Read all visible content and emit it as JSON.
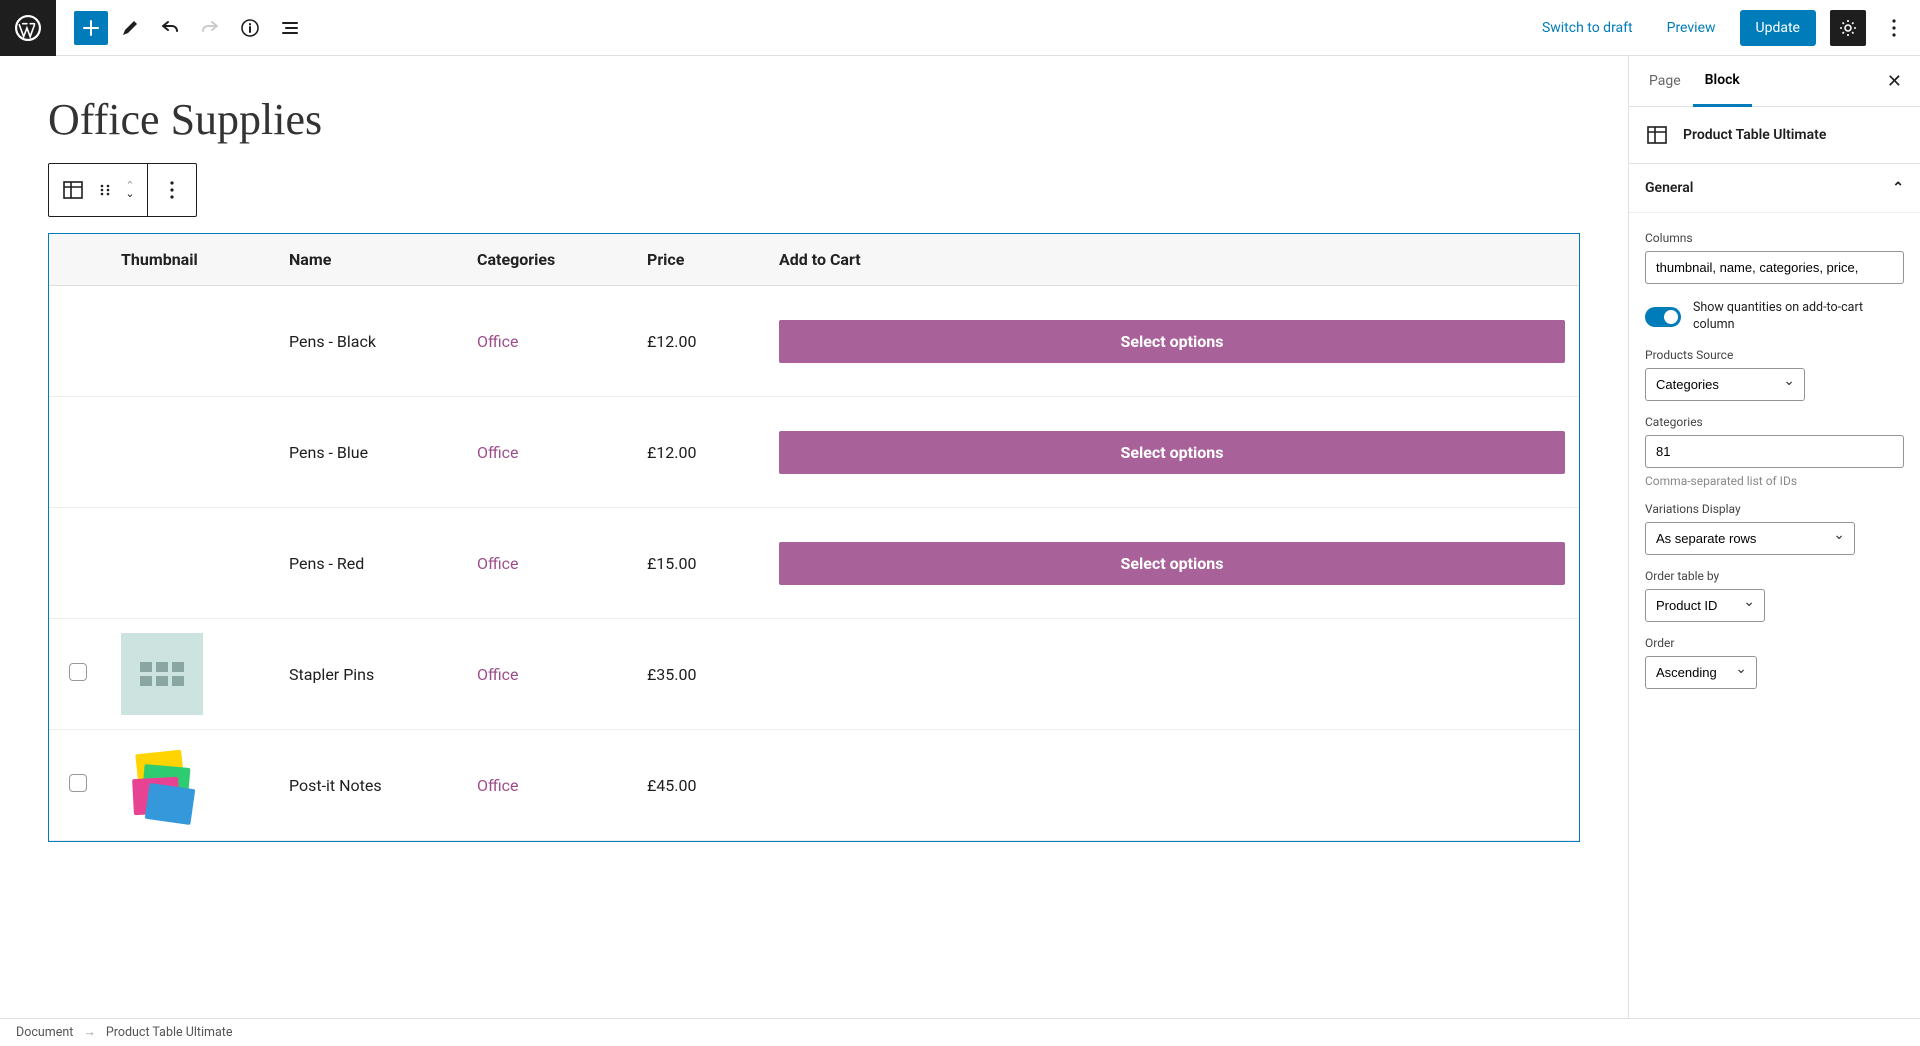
{
  "toolbar": {
    "switch_draft": "Switch to draft",
    "preview": "Preview",
    "update": "Update"
  },
  "page": {
    "title": "Office Supplies"
  },
  "table": {
    "headers": {
      "thumbnail": "Thumbnail",
      "name": "Name",
      "categories": "Categories",
      "price": "Price",
      "add_to_cart": "Add to Cart"
    },
    "rows": [
      {
        "name": "Pens - Black",
        "category": "Office",
        "price": "£12.00",
        "variant": true,
        "show_check": false,
        "thumb": "pens"
      },
      {
        "name": "Pens - Blue",
        "category": "Office",
        "price": "£12.00",
        "variant": true,
        "show_check": false,
        "thumb": "pens"
      },
      {
        "name": "Pens - Red",
        "category": "Office",
        "price": "£15.00",
        "variant": true,
        "show_check": false,
        "thumb": "pens"
      },
      {
        "name": "Stapler Pins",
        "category": "Office",
        "price": "£35.00",
        "variant": false,
        "show_check": true,
        "thumb": "stapler"
      },
      {
        "name": "Post-it Notes",
        "category": "Office",
        "price": "£45.00",
        "variant": false,
        "show_check": true,
        "thumb": "postit"
      }
    ],
    "select_options_label": "Select options"
  },
  "sidebar": {
    "tabs": {
      "page": "Page",
      "block": "Block"
    },
    "block_name": "Product Table Ultimate",
    "panel_general": "General",
    "columns_label": "Columns",
    "columns_value": "thumbnail, name, categories, price,",
    "quantities_toggle": "Show quantities on add-to-cart column",
    "source_label": "Products Source",
    "source_value": "Categories",
    "categories_label": "Categories",
    "categories_value": "81",
    "categories_help": "Comma-separated list of IDs",
    "variations_label": "Variations Display",
    "variations_value": "As separate rows",
    "orderby_label": "Order table by",
    "orderby_value": "Product ID",
    "order_label": "Order",
    "order_value": "Ascending"
  },
  "breadcrumb": {
    "root": "Document",
    "current": "Product Table Ultimate"
  }
}
